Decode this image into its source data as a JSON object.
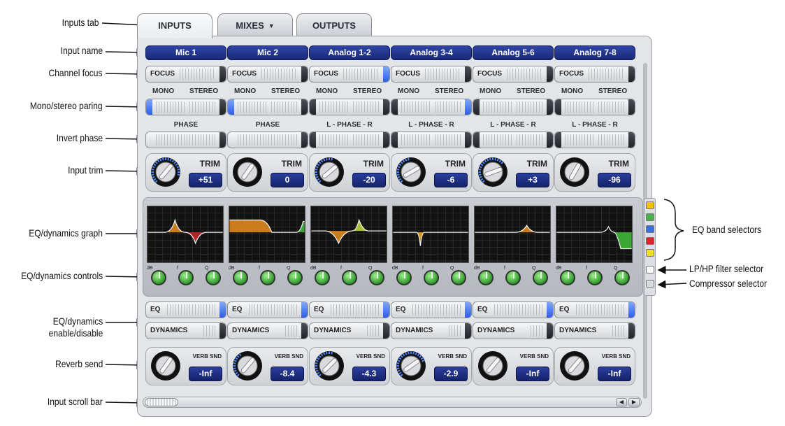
{
  "tabs": [
    {
      "label": "INPUTS",
      "active": true
    },
    {
      "label": "MIXES",
      "dropdown": true
    },
    {
      "label": "OUTPUTS"
    }
  ],
  "channels": [
    {
      "name": "Mic 1",
      "phase_label": "PHASE",
      "stereo": false,
      "trim": "+51",
      "reverb": "-Inf",
      "eq_on": true
    },
    {
      "name": "Mic 2",
      "phase_label": "PHASE",
      "stereo": false,
      "trim": "0",
      "reverb": "-8.4",
      "eq_on": true
    },
    {
      "name": "Analog 1-2",
      "phase_label": "L - PHASE - R",
      "stereo": true,
      "trim": "-20",
      "reverb": "-4.3",
      "eq_on": true
    },
    {
      "name": "Analog 3-4",
      "phase_label": "L - PHASE - R",
      "stereo": true,
      "trim": "-6",
      "reverb": "-2.9",
      "eq_on": true
    },
    {
      "name": "Analog 5-6",
      "phase_label": "L - PHASE - R",
      "stereo": true,
      "trim": "+3",
      "reverb": "-Inf",
      "eq_on": true
    },
    {
      "name": "Analog 7-8",
      "phase_label": "L - PHASE - R",
      "stereo": true,
      "trim": "-96",
      "reverb": "-Inf",
      "eq_on": true
    }
  ],
  "labels": {
    "focus": "FOCUS",
    "mono": "MONO",
    "stereo": "STEREO",
    "trim": "TRIM",
    "eq": "EQ",
    "dynamics": "DYNAMICS",
    "verb_send": "VERB SND",
    "knob_db": "dB",
    "knob_f": "f",
    "knob_q": "Q"
  },
  "callouts": {
    "inputs_tab": "Inputs tab",
    "input_name": "Input name",
    "channel_focus": "Channel focus",
    "mono_stereo": "Mono/stereo paring",
    "invert_phase": "Invert phase",
    "input_trim": "Input trim",
    "eq_graph": "EQ/dynamics graph",
    "eq_controls": "EQ/dynamics controls",
    "eq_enable_1": "EQ/dynamics",
    "eq_enable_2": "enable/disable",
    "reverb_send": "Reverb send",
    "scroll_bar": "Input scroll bar",
    "eq_band": "EQ band selectors",
    "lp_hp": "LP/HP filter selector",
    "compressor": "Compressor selector"
  },
  "colors": {
    "name_bg": "#1f3190",
    "value_bg": "#1d2e85",
    "switch_on": "#2e5ce8",
    "knob_green": "#3fb83a",
    "graph_bg": "#121212",
    "band_colors": [
      "#f2c200",
      "#4bb04b",
      "#3a6fe0",
      "#d42a2a",
      "#f0e020",
      "#ffffff"
    ]
  }
}
